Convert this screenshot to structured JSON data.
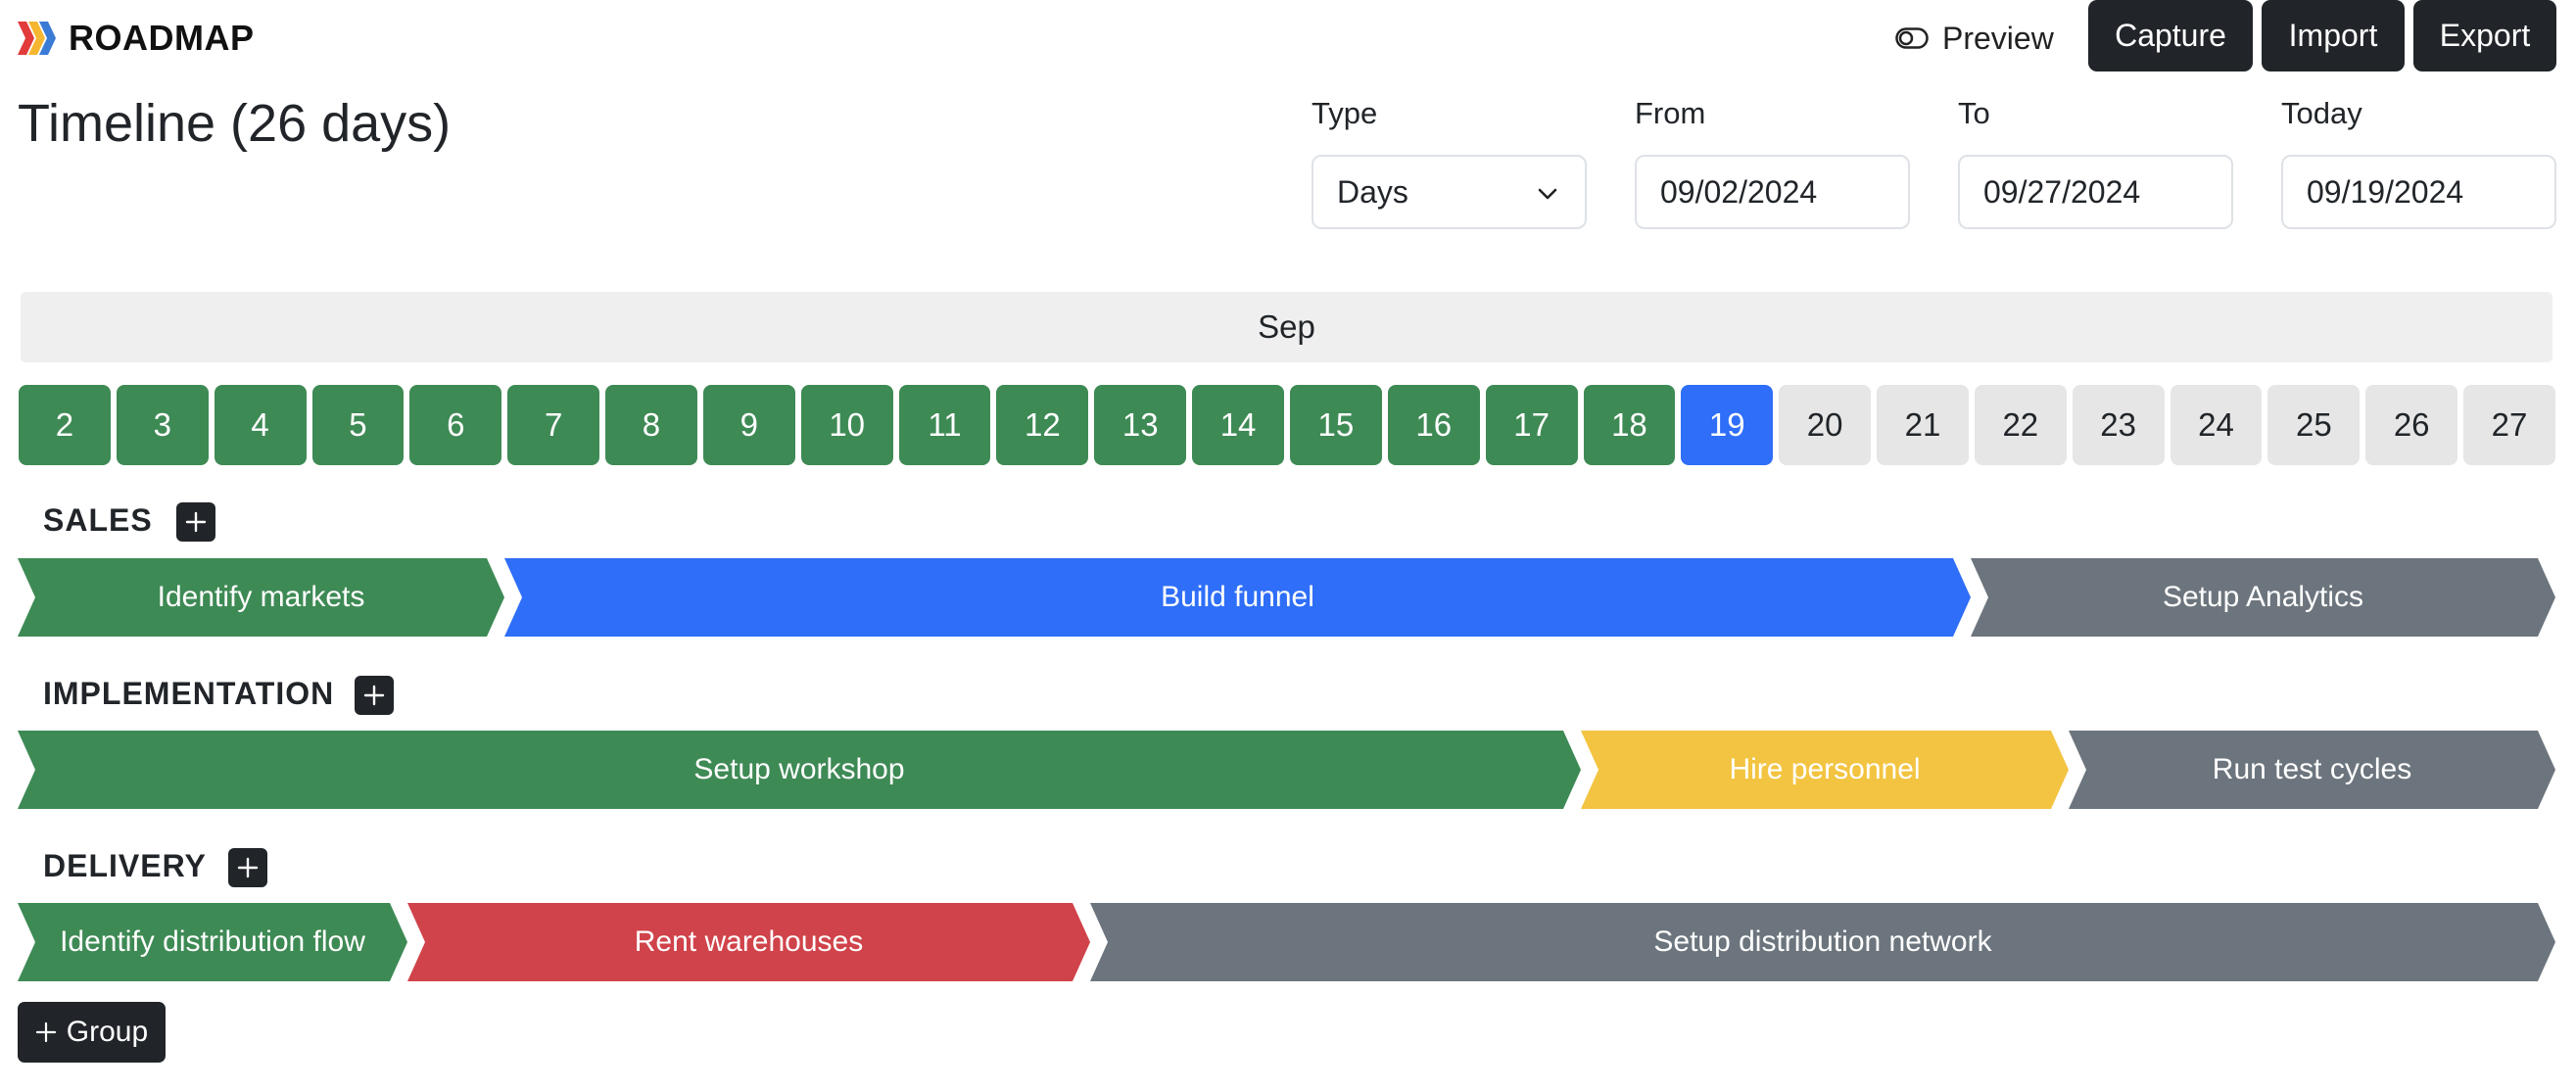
{
  "app": {
    "logo_text": "ROADMAP"
  },
  "toolbar": {
    "preview_label": "Preview",
    "capture_label": "Capture",
    "import_label": "Import",
    "export_label": "Export"
  },
  "page": {
    "title": "Timeline (26 days)"
  },
  "filters": {
    "type_label": "Type",
    "type_value": "Days",
    "from_label": "From",
    "from_value": "09/02/2024",
    "to_label": "To",
    "to_value": "09/27/2024",
    "today_label": "Today",
    "today_value": "09/19/2024"
  },
  "timeline": {
    "month": "Sep",
    "days": [
      "2",
      "3",
      "4",
      "5",
      "6",
      "7",
      "8",
      "9",
      "10",
      "11",
      "12",
      "13",
      "14",
      "15",
      "16",
      "17",
      "18",
      "19",
      "20",
      "21",
      "22",
      "23",
      "24",
      "25",
      "26",
      "27"
    ],
    "today_index": 17
  },
  "colors": {
    "green": "#3e8a55",
    "blue": "#2e6ef8",
    "gray": "#6c757d",
    "yellow": "#f3c441",
    "red": "#d0434a",
    "dark": "#212529"
  },
  "groups": [
    {
      "name": "SALES",
      "tasks": [
        {
          "label": "Identify markets",
          "color": "#3e8a55"
        },
        {
          "label": "Build funnel",
          "color": "#2e6ef8"
        },
        {
          "label": "Setup Analytics",
          "color": "#6c757d"
        }
      ]
    },
    {
      "name": "IMPLEMENTATION",
      "tasks": [
        {
          "label": "Setup workshop",
          "color": "#3e8a55"
        },
        {
          "label": "Hire personnel",
          "color": "#f3c441"
        },
        {
          "label": "Run test cycles",
          "color": "#6c757d"
        }
      ]
    },
    {
      "name": "DELIVERY",
      "tasks": [
        {
          "label": "Identify distribution flow",
          "color": "#3e8a55"
        },
        {
          "label": "Rent warehouses",
          "color": "#d0434a"
        },
        {
          "label": "Setup distribution network",
          "color": "#6c757d"
        }
      ]
    }
  ],
  "footer": {
    "add_group_label": "Group"
  }
}
